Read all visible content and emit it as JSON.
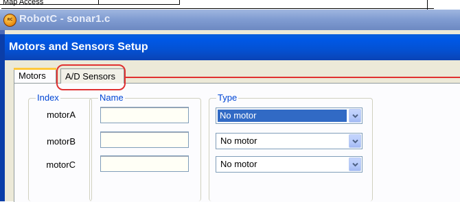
{
  "background_window": {
    "text": "Map Access"
  },
  "app": {
    "title": "RobotC - sonar1.c",
    "icon": "robotc-logo-icon"
  },
  "dialog": {
    "title": "Motors and Sensors Setup"
  },
  "tabs": [
    {
      "label": "Motors",
      "selected": true
    },
    {
      "label": "A/D Sensors",
      "selected": false,
      "highlighted": true
    }
  ],
  "groups": {
    "index_label": "Index",
    "name_label": "Name",
    "type_label": "Type"
  },
  "motors": [
    {
      "index": "motorA",
      "name": "",
      "type": "No motor",
      "selected": true
    },
    {
      "index": "motorB",
      "name": "",
      "type": "No motor",
      "selected": false
    },
    {
      "index": "motorC",
      "name": "",
      "type": "No motor",
      "selected": false
    }
  ],
  "colors": {
    "dialog_title_bar": "#0058e6",
    "app_title_bar_inactive": "#7f9bd1",
    "highlight": "#e03030",
    "group_label": "#0046d5",
    "selection": "#316ac5"
  }
}
